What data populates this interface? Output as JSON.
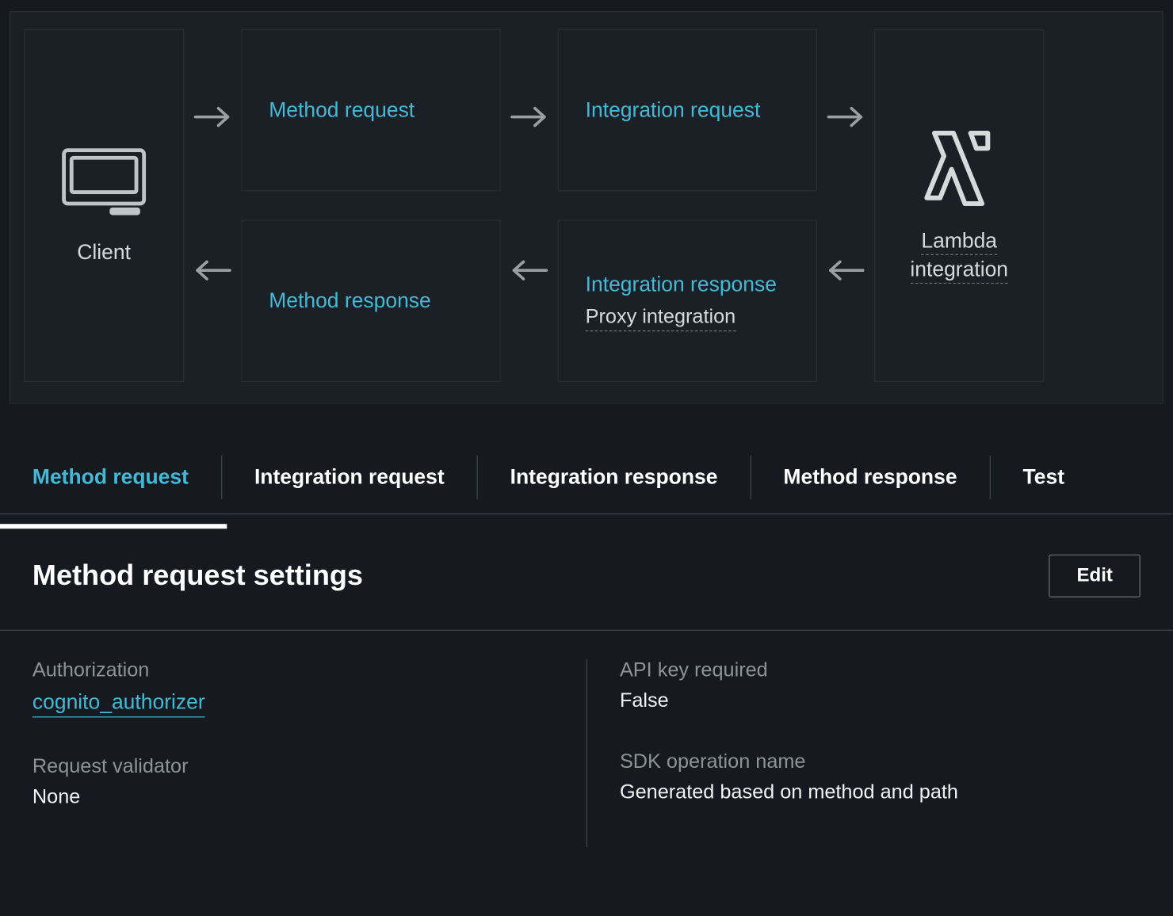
{
  "flow": {
    "client_label": "Client",
    "method_request": "Method request",
    "integration_request": "Integration request",
    "method_response": "Method response",
    "integration_response": "Integration response",
    "proxy_integration": "Proxy integration",
    "lambda_label": "Lambda integration"
  },
  "tabs": {
    "method_request": "Method request",
    "integration_request": "Integration request",
    "integration_response": "Integration response",
    "method_response": "Method response",
    "test": "Test"
  },
  "settings": {
    "title": "Method request settings",
    "edit": "Edit",
    "authorization_label": "Authorization",
    "authorization_value": "cognito_authorizer",
    "api_key_label": "API key required",
    "api_key_value": "False",
    "validator_label": "Request validator",
    "validator_value": "None",
    "sdk_label": "SDK operation name",
    "sdk_value": "Generated based on method and path"
  }
}
